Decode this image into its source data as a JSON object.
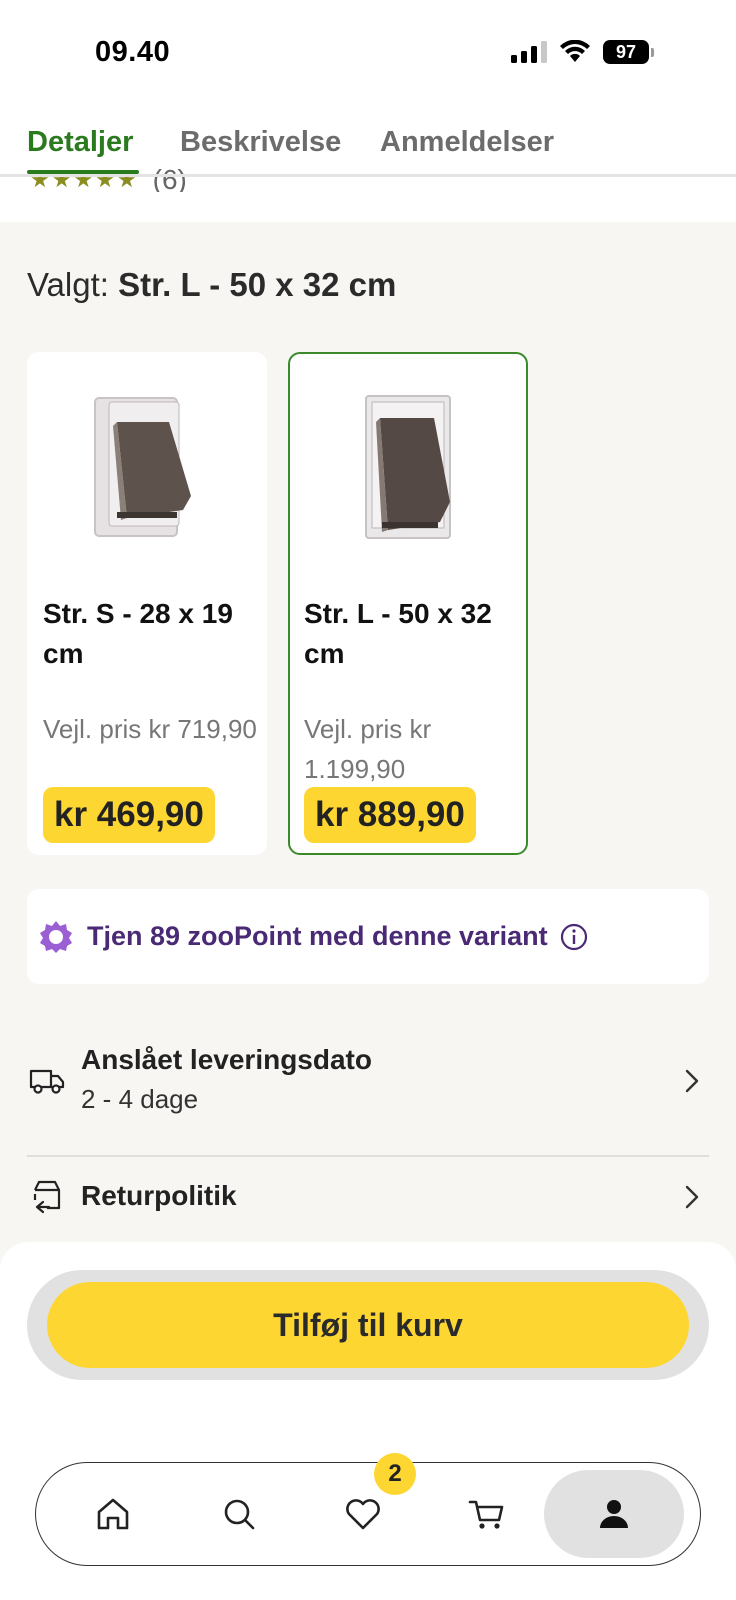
{
  "status_bar": {
    "time": "09.40",
    "battery": "97"
  },
  "tabs": [
    {
      "label": "Detaljer",
      "active": true
    },
    {
      "label": "Beskrivelse",
      "active": false
    },
    {
      "label": "Anmeldelser",
      "active": false
    }
  ],
  "rating_peek": {
    "stars": "★★★★★",
    "count": "(6)"
  },
  "selected": {
    "label": "Valgt:",
    "value": "Str. L - 50 x 32 cm"
  },
  "variants": [
    {
      "name": "Str. S - 28 x 19 cm",
      "rrp": "Vejl. pris kr 719,90",
      "price": "kr 469,90",
      "selected": false
    },
    {
      "name": "Str. L - 50 x 32 cm",
      "rrp": "Vejl. pris kr 1.199,90",
      "price": "kr 889,90",
      "selected": true
    }
  ],
  "points": {
    "text": "Tjen 89 zooPoint med denne variant"
  },
  "delivery": {
    "title": "Anslået leveringsdato",
    "subtitle": "2 - 4 dage"
  },
  "returns": {
    "title": "Returpolitik"
  },
  "cart_button": {
    "label": "Tilføj til kurv"
  },
  "nav": {
    "favorites_badge": "2"
  },
  "colors": {
    "accent_green": "#2a7a1e",
    "price_yellow": "#fed631",
    "points_purple": "#4a2a74"
  }
}
